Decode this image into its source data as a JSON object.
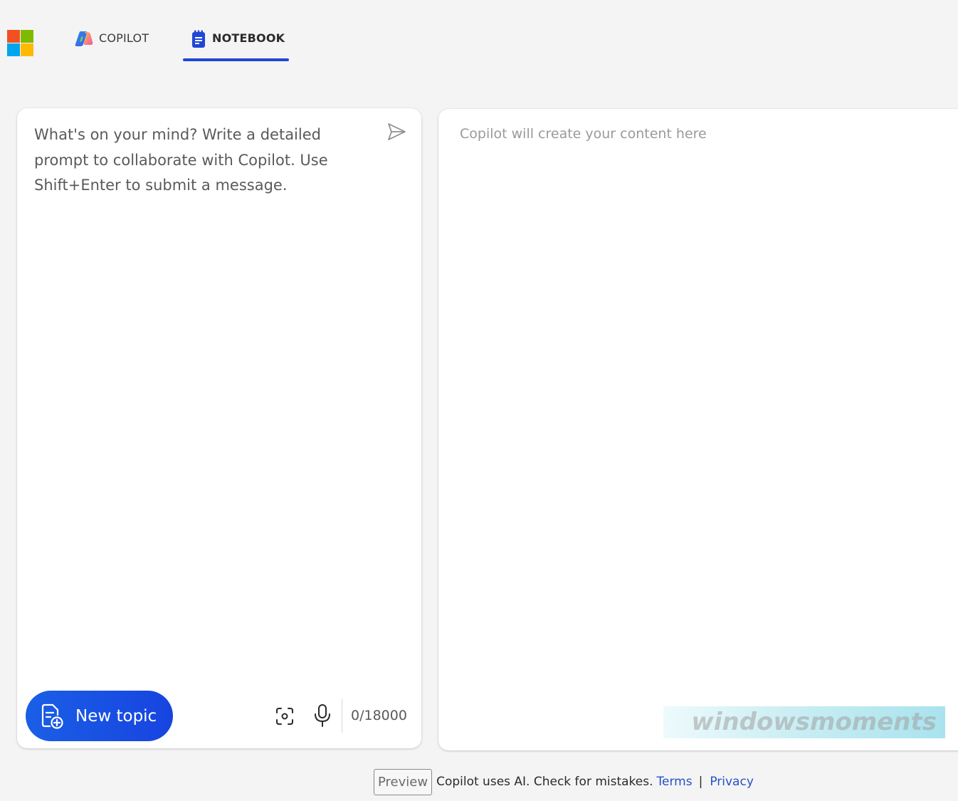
{
  "header": {
    "tabs": [
      {
        "label": "COPILOT",
        "icon": "copilot-logo-icon",
        "active": false
      },
      {
        "label": "NOTEBOOK",
        "icon": "notebook-icon",
        "active": true
      }
    ],
    "accent_color": "#1f47d6"
  },
  "composer": {
    "placeholder": "What's on your mind? Write a detailed prompt to collaborate with Copilot. Use Shift+Enter to submit a message.",
    "value": "",
    "send_icon": "send-icon",
    "new_topic_label": "New topic",
    "new_topic_icon": "new-topic-icon",
    "scan_icon": "screenshot-scan-icon",
    "mic_icon": "microphone-icon",
    "char_count": "0/18000"
  },
  "output": {
    "placeholder": "Copilot will create your content here"
  },
  "watermark": {
    "text": "windowsmoments"
  },
  "footer": {
    "badge": "Preview",
    "disclaimer": "Copilot uses AI. Check for mistakes.",
    "terms_label": "Terms",
    "separator": "|",
    "privacy_label": "Privacy",
    "link_color": "#2651c4"
  }
}
